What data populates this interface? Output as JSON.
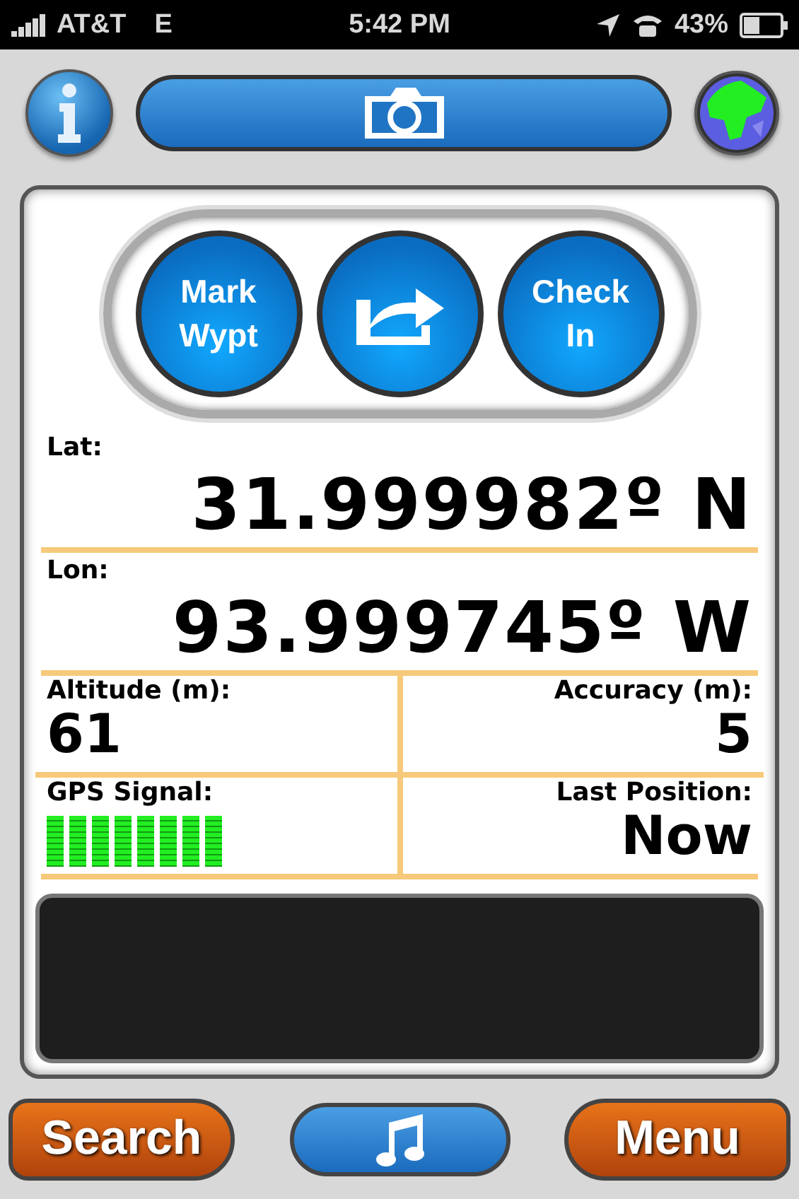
{
  "status_bar": {
    "carrier": "AT&T",
    "network": "E",
    "time": "5:42 PM",
    "battery": "43%"
  },
  "action_buttons": [
    {
      "kind": "text",
      "label": "Mark\nWypt"
    },
    {
      "kind": "share"
    },
    {
      "kind": "text",
      "label": "Check\nIn"
    }
  ],
  "lat": {
    "label": "Lat:",
    "value": "31.999982º N"
  },
  "lon": {
    "label": "Lon:",
    "value": "93.999745º W"
  },
  "altitude": {
    "label": "Altitude (m):",
    "value": "61"
  },
  "accuracy": {
    "label": "Accuracy (m):",
    "value": "5"
  },
  "gps_signal": {
    "label": "GPS Signal:",
    "level": 1
  },
  "last_position": {
    "label": "Last Position:",
    "value": "Now"
  },
  "bottom_bar": {
    "left": "Search",
    "right": "Menu"
  }
}
